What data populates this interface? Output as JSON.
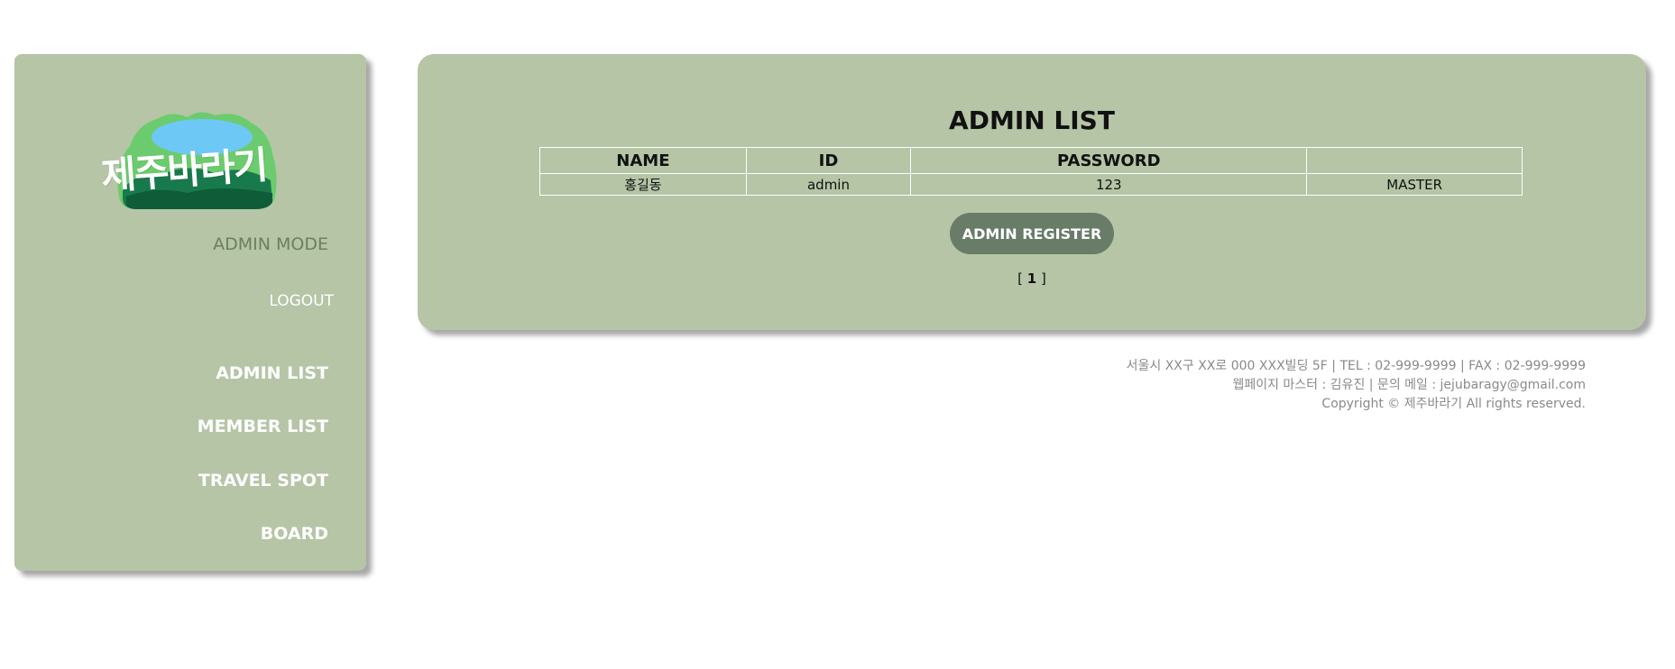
{
  "sidebar": {
    "logo_text": "제주바라기",
    "mode_label": "ADMIN MODE",
    "logout_label": "LOGOUT",
    "nav": [
      "ADMIN LIST",
      "MEMBER LIST",
      "TRAVEL SPOT",
      "BOARD"
    ]
  },
  "main": {
    "title": "ADMIN LIST",
    "table": {
      "headers": [
        "NAME",
        "ID",
        "PASSWORD",
        ""
      ],
      "rows": [
        [
          "홍길동",
          "admin",
          "123",
          "MASTER"
        ]
      ]
    },
    "register_label": "ADMIN REGISTER",
    "pager": {
      "open": "[ ",
      "current": "1",
      "close": " ]"
    }
  },
  "footer": {
    "line1": "서울시 XX구 XX로 000 XXX빌딩 5F | TEL : 02-999-9999 | FAX : 02-999-9999",
    "line2": "웹페이지 마스터 : 김유진 | 문의 메일 : jejubaragy@gmail.com",
    "line3": "Copyright © 제주바라기 All rights reserved."
  },
  "colors": {
    "panel": "#b5c5a6",
    "button": "#687c68",
    "mode_text": "#6b7f61",
    "footer_text": "#8a8a8a"
  }
}
